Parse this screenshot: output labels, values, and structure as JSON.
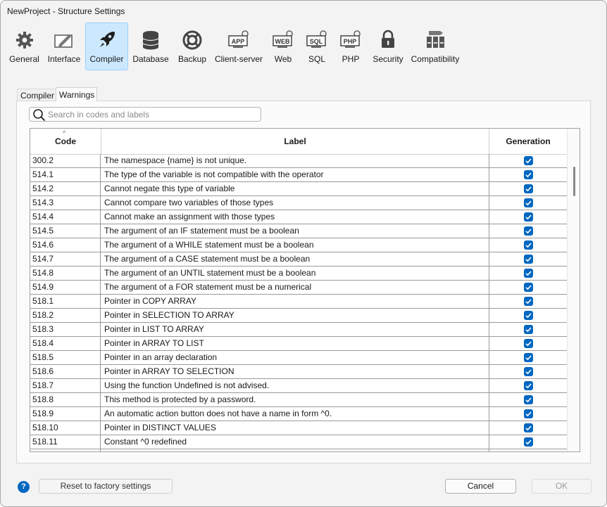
{
  "window": {
    "title": "NewProject - Structure Settings"
  },
  "toolbar": {
    "items": [
      {
        "label": "General",
        "icon": "gear-icon"
      },
      {
        "label": "Interface",
        "icon": "interface-icon"
      },
      {
        "label": "Compiler",
        "icon": "rocket-icon",
        "active": true
      },
      {
        "label": "Database",
        "icon": "database-icon"
      },
      {
        "label": "Backup",
        "icon": "lifebuoy-icon"
      },
      {
        "label": "Client-server",
        "icon": "app-icon",
        "badge": "APP"
      },
      {
        "label": "Web",
        "icon": "web-icon",
        "badge": "WEB"
      },
      {
        "label": "SQL",
        "icon": "sql-icon",
        "badge": "SQL"
      },
      {
        "label": "PHP",
        "icon": "php-icon",
        "badge": "PHP"
      },
      {
        "label": "Security",
        "icon": "lock-icon"
      },
      {
        "label": "Compatibility",
        "icon": "compatibility-icon"
      }
    ]
  },
  "tabs": {
    "compiler": "Compiler",
    "warnings": "Warnings"
  },
  "search": {
    "placeholder": "Search in codes and labels",
    "value": ""
  },
  "grid": {
    "columns": {
      "code": "Code",
      "label": "Label",
      "generation": "Generation"
    },
    "rows": [
      {
        "code": "300.2",
        "label": "The namespace {name} is not unique.",
        "generation": true
      },
      {
        "code": "514.1",
        "label": "The type of the variable is not compatible with the operator",
        "generation": true
      },
      {
        "code": "514.2",
        "label": "Cannot negate this type of variable",
        "generation": true
      },
      {
        "code": "514.3",
        "label": "Cannot compare two variables of those types",
        "generation": true
      },
      {
        "code": "514.4",
        "label": "Cannot make an assignment with those types",
        "generation": true
      },
      {
        "code": "514.5",
        "label": "The argument of an IF statement must be a boolean",
        "generation": true
      },
      {
        "code": "514.6",
        "label": "The argument of a WHILE statement must be a boolean",
        "generation": true
      },
      {
        "code": "514.7",
        "label": "The argument of a CASE statement must be a boolean",
        "generation": true
      },
      {
        "code": "514.8",
        "label": "The argument of an UNTIL statement must be a boolean",
        "generation": true
      },
      {
        "code": "514.9",
        "label": "The argument of a FOR statement must be a numerical",
        "generation": true
      },
      {
        "code": "518.1",
        "label": "Pointer in COPY ARRAY",
        "generation": true
      },
      {
        "code": "518.2",
        "label": "Pointer in SELECTION TO ARRAY",
        "generation": true
      },
      {
        "code": "518.3",
        "label": "Pointer in LIST TO ARRAY",
        "generation": true
      },
      {
        "code": "518.4",
        "label": "Pointer in ARRAY TO LIST",
        "generation": true
      },
      {
        "code": "518.5",
        "label": "Pointer in an array declaration",
        "generation": true
      },
      {
        "code": "518.6",
        "label": "Pointer in ARRAY TO SELECTION",
        "generation": true
      },
      {
        "code": "518.7",
        "label": "Using the function Undefined is not advised.",
        "generation": true
      },
      {
        "code": "518.8",
        "label": "This method is protected by a password.",
        "generation": true
      },
      {
        "code": "518.9",
        "label": "An automatic action button does not have a name in form ^0.",
        "generation": true
      },
      {
        "code": "518.10",
        "label": "Pointer in DISTINCT VALUES",
        "generation": true
      },
      {
        "code": "518.11",
        "label": "Constant ^0 redefined",
        "generation": true
      },
      {
        "code": "",
        "label": "",
        "generation": true
      }
    ]
  },
  "footer": {
    "help": "?",
    "reset": "Reset to factory settings",
    "cancel": "Cancel",
    "ok": "OK"
  },
  "colors": {
    "accent": "#0067c0",
    "active_tool_bg": "#cce8ff"
  }
}
